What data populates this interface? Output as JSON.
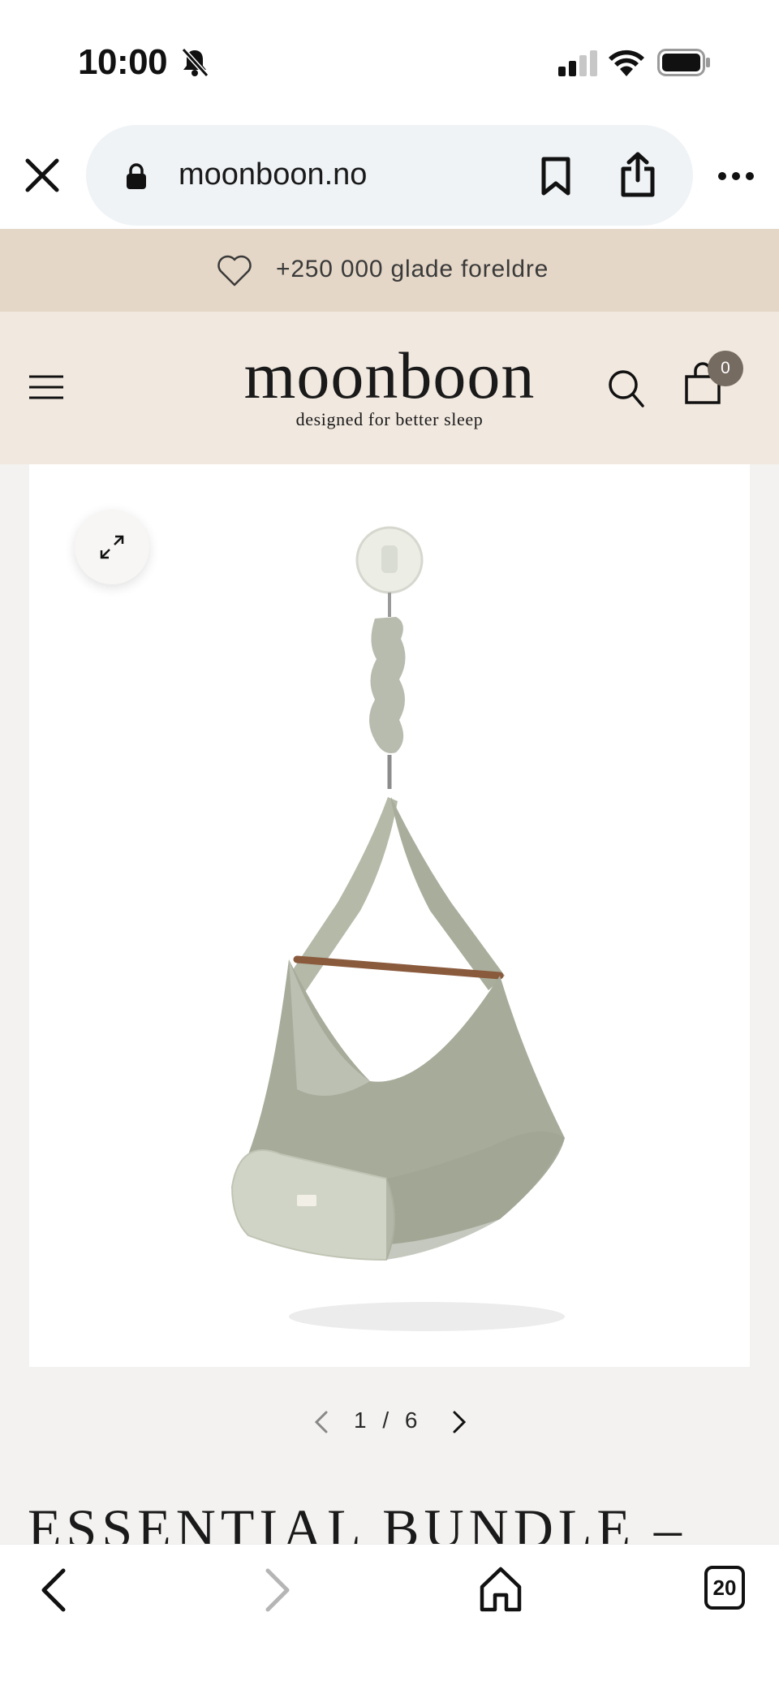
{
  "status_bar": {
    "time": "10:00",
    "icons": [
      "bell-slash-icon",
      "cellular-signal-icon",
      "wifi-icon",
      "battery-icon"
    ]
  },
  "browser": {
    "url": "moonboon.no",
    "icons": [
      "close-icon",
      "lock-icon",
      "bookmark-icon",
      "share-icon",
      "more-icon"
    ]
  },
  "promo": {
    "text": "+250 000 glade foreldre",
    "icon": "heart-icon"
  },
  "header": {
    "logo_word": "moonboon",
    "logo_tagline": "designed for better sleep",
    "cart_count": "0",
    "icons": [
      "hamburger-menu-icon",
      "search-icon",
      "shopping-bag-icon"
    ]
  },
  "gallery": {
    "expand_icon": "expand-icon",
    "image_alt": "Moonboon baby hammock with motor, sage green",
    "pager_text": "1 / 6"
  },
  "product": {
    "title": "ESSENTIAL BUNDLE –"
  },
  "toolbar": {
    "tabs_count": "20",
    "icons": [
      "back-icon",
      "forward-icon",
      "home-icon",
      "tabs-icon"
    ]
  },
  "colors": {
    "promo_bg": "#e5d7c7",
    "header_bg": "#f1e8df",
    "page_bg": "#f3f2f0",
    "badge_bg": "#766b61",
    "url_pill_bg": "#eff3f6"
  }
}
